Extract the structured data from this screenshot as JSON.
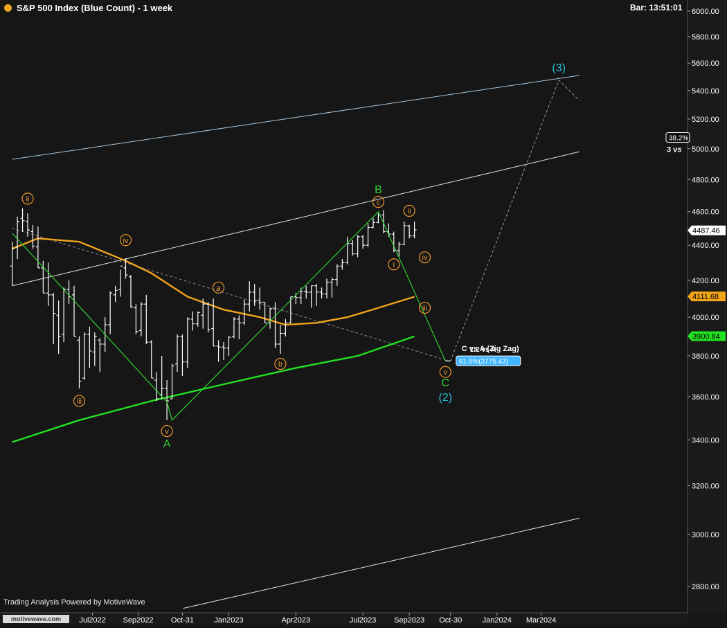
{
  "header": {
    "title": "S&P 500 Index (Blue Count) - 1 week",
    "bar_time": "Bar: 13:51:01"
  },
  "footer": {
    "powered_by": "Trading Analysis Powered by MotiveWave",
    "logo_text": "motivewave.com"
  },
  "colors": {
    "background": "#161616",
    "axis_panel": "#1a1a1a",
    "price_bars": "#ffffff",
    "wave_green": "#2fd02f",
    "wave_orange": "#f29a2e",
    "wave_cyan": "#29c0d6",
    "ma_orange": "#f2a51a",
    "ma_green": "#22e022",
    "channel_blue": "#a9c6dc",
    "channel_white": "#e6e6e6",
    "dashed": "#8a8a8a",
    "price_tag_bg": "#ffffff",
    "fib_tag_bg": "#3fb6ff"
  },
  "chart_data": {
    "type": "ohlc-bar",
    "title": "S&P 500 Index (Blue Count) - 1 week",
    "y_scale": "log",
    "ylim": [
      2700,
      6000
    ],
    "y_ticks": [
      2800,
      3000,
      3200,
      3400,
      3600,
      3800,
      4000,
      4200,
      4400,
      4600,
      4800,
      5000,
      5200,
      5400,
      5600,
      5800,
      6000
    ],
    "y_tick_labels": [
      "2800.00",
      "3000.00",
      "3200.00",
      "3400.00",
      "3600.00",
      "3800.00",
      "4000.00",
      "4200.00",
      "4400.00",
      "4600.00",
      "4800.00",
      "5000.00",
      "5200.00",
      "5400.00",
      "5600.00",
      "5800.00",
      "6000.00"
    ],
    "x_range": [
      "2022-03-14",
      "2024-04-22"
    ],
    "x_ticks": [
      {
        "date": "2022-07-01",
        "label": "Jul2022"
      },
      {
        "date": "2022-09-01",
        "label": "Sep2022"
      },
      {
        "date": "2022-10-31",
        "label": "Oct-31"
      },
      {
        "date": "2023-01-02",
        "label": "Jan2023"
      },
      {
        "date": "2023-04-03",
        "label": "Apr2023"
      },
      {
        "date": "2023-07-03",
        "label": "Jul2023"
      },
      {
        "date": "2023-09-04",
        "label": "Sep2023"
      },
      {
        "date": "2023-10-30",
        "label": "Oct-30"
      },
      {
        "date": "2024-01-01",
        "label": "Jan2024"
      },
      {
        "date": "2024-03-01",
        "label": "Mar2024"
      }
    ],
    "grid": false,
    "bars": [
      {
        "d": "2022-03-14",
        "o": 4280,
        "h": 4420,
        "l": 4170,
        "c": 4380
      },
      {
        "d": "2022-03-21",
        "o": 4390,
        "h": 4570,
        "l": 4320,
        "c": 4540
      },
      {
        "d": "2022-03-28",
        "o": 4560,
        "h": 4620,
        "l": 4480,
        "c": 4545
      },
      {
        "d": "2022-04-04",
        "o": 4540,
        "h": 4590,
        "l": 4450,
        "c": 4490
      },
      {
        "d": "2022-04-11",
        "o": 4480,
        "h": 4520,
        "l": 4380,
        "c": 4395
      },
      {
        "d": "2022-04-18",
        "o": 4390,
        "h": 4510,
        "l": 4270,
        "c": 4270
      },
      {
        "d": "2022-04-25",
        "o": 4270,
        "h": 4310,
        "l": 4130,
        "c": 4130
      },
      {
        "d": "2022-05-02",
        "o": 4130,
        "h": 4300,
        "l": 4060,
        "c": 4120
      },
      {
        "d": "2022-05-09",
        "o": 4120,
        "h": 4130,
        "l": 3860,
        "c": 4020
      },
      {
        "d": "2022-05-16",
        "o": 4010,
        "h": 4090,
        "l": 3810,
        "c": 3900
      },
      {
        "d": "2022-05-23",
        "o": 3910,
        "h": 4160,
        "l": 3870,
        "c": 4150
      },
      {
        "d": "2022-05-30",
        "o": 4150,
        "h": 4200,
        "l": 4070,
        "c": 4110
      },
      {
        "d": "2022-06-06",
        "o": 4120,
        "h": 4170,
        "l": 3900,
        "c": 3900
      },
      {
        "d": "2022-06-13",
        "o": 3880,
        "h": 3900,
        "l": 3640,
        "c": 3675
      },
      {
        "d": "2022-06-20",
        "o": 3690,
        "h": 3920,
        "l": 3680,
        "c": 3910
      },
      {
        "d": "2022-06-27",
        "o": 3910,
        "h": 3950,
        "l": 3740,
        "c": 3825
      },
      {
        "d": "2022-07-04",
        "o": 3820,
        "h": 3920,
        "l": 3750,
        "c": 3900
      },
      {
        "d": "2022-07-11",
        "o": 3880,
        "h": 3890,
        "l": 3720,
        "c": 3860
      },
      {
        "d": "2022-07-18",
        "o": 3860,
        "h": 4000,
        "l": 3820,
        "c": 3960
      },
      {
        "d": "2022-07-25",
        "o": 3960,
        "h": 4140,
        "l": 3910,
        "c": 4130
      },
      {
        "d": "2022-08-01",
        "o": 4120,
        "h": 4170,
        "l": 4080,
        "c": 4145
      },
      {
        "d": "2022-08-08",
        "o": 4150,
        "h": 4260,
        "l": 4110,
        "c": 4280
      },
      {
        "d": "2022-08-15",
        "o": 4270,
        "h": 4325,
        "l": 4210,
        "c": 4230
      },
      {
        "d": "2022-08-22",
        "o": 4220,
        "h": 4230,
        "l": 4050,
        "c": 4055
      },
      {
        "d": "2022-08-29",
        "o": 4050,
        "h": 4070,
        "l": 3910,
        "c": 3925
      },
      {
        "d": "2022-09-05",
        "o": 3930,
        "h": 4080,
        "l": 3900,
        "c": 4070
      },
      {
        "d": "2022-09-12",
        "o": 4070,
        "h": 4120,
        "l": 3860,
        "c": 3870
      },
      {
        "d": "2022-09-19",
        "o": 3870,
        "h": 3880,
        "l": 3690,
        "c": 3690
      },
      {
        "d": "2022-09-26",
        "o": 3680,
        "h": 3720,
        "l": 3580,
        "c": 3590
      },
      {
        "d": "2022-10-03",
        "o": 3610,
        "h": 3800,
        "l": 3590,
        "c": 3640
      },
      {
        "d": "2022-10-10",
        "o": 3640,
        "h": 3680,
        "l": 3490,
        "c": 3580
      },
      {
        "d": "2022-10-17",
        "o": 3590,
        "h": 3760,
        "l": 3590,
        "c": 3750
      },
      {
        "d": "2022-10-24",
        "o": 3760,
        "h": 3910,
        "l": 3720,
        "c": 3900
      },
      {
        "d": "2022-10-31",
        "o": 3900,
        "h": 3910,
        "l": 3700,
        "c": 3770
      },
      {
        "d": "2022-11-07",
        "o": 3770,
        "h": 4000,
        "l": 3740,
        "c": 3990
      },
      {
        "d": "2022-11-14",
        "o": 3990,
        "h": 4030,
        "l": 3930,
        "c": 3965
      },
      {
        "d": "2022-11-21",
        "o": 3965,
        "h": 4030,
        "l": 3950,
        "c": 4025
      },
      {
        "d": "2022-11-28",
        "o": 4010,
        "h": 4100,
        "l": 3940,
        "c": 4070
      },
      {
        "d": "2022-12-05",
        "o": 4070,
        "h": 4080,
        "l": 3920,
        "c": 3935
      },
      {
        "d": "2022-12-12",
        "o": 3940,
        "h": 4100,
        "l": 3850,
        "c": 3850
      },
      {
        "d": "2022-12-19",
        "o": 3850,
        "h": 3880,
        "l": 3770,
        "c": 3845
      },
      {
        "d": "2022-12-26",
        "o": 3845,
        "h": 3870,
        "l": 3780,
        "c": 3840
      },
      {
        "d": "2023-01-02",
        "o": 3840,
        "h": 3900,
        "l": 3800,
        "c": 3895
      },
      {
        "d": "2023-01-09",
        "o": 3900,
        "h": 4000,
        "l": 3890,
        "c": 3990
      },
      {
        "d": "2023-01-16",
        "o": 3990,
        "h": 4010,
        "l": 3885,
        "c": 3970
      },
      {
        "d": "2023-01-23",
        "o": 3970,
        "h": 4095,
        "l": 3960,
        "c": 4070
      },
      {
        "d": "2023-01-30",
        "o": 4070,
        "h": 4195,
        "l": 4030,
        "c": 4135
      },
      {
        "d": "2023-02-06",
        "o": 4135,
        "h": 4180,
        "l": 4060,
        "c": 4090
      },
      {
        "d": "2023-02-13",
        "o": 4090,
        "h": 4160,
        "l": 4040,
        "c": 4080
      },
      {
        "d": "2023-02-20",
        "o": 4080,
        "h": 4080,
        "l": 3970,
        "c": 3970
      },
      {
        "d": "2023-02-27",
        "o": 3970,
        "h": 4050,
        "l": 3940,
        "c": 4045
      },
      {
        "d": "2023-03-06",
        "o": 4045,
        "h": 4080,
        "l": 3840,
        "c": 3860
      },
      {
        "d": "2023-03-13",
        "o": 3860,
        "h": 3960,
        "l": 3810,
        "c": 3915
      },
      {
        "d": "2023-03-20",
        "o": 3915,
        "h": 3990,
        "l": 3900,
        "c": 3970
      },
      {
        "d": "2023-03-27",
        "o": 3970,
        "h": 4110,
        "l": 3970,
        "c": 4110
      },
      {
        "d": "2023-04-03",
        "o": 4110,
        "h": 4130,
        "l": 4070,
        "c": 4105
      },
      {
        "d": "2023-04-10",
        "o": 4105,
        "h": 4160,
        "l": 4070,
        "c": 4140
      },
      {
        "d": "2023-04-17",
        "o": 4140,
        "h": 4170,
        "l": 4100,
        "c": 4135
      },
      {
        "d": "2023-04-24",
        "o": 4135,
        "h": 4170,
        "l": 4050,
        "c": 4170
      },
      {
        "d": "2023-05-01",
        "o": 4170,
        "h": 4180,
        "l": 4060,
        "c": 4135
      },
      {
        "d": "2023-05-08",
        "o": 4135,
        "h": 4160,
        "l": 4100,
        "c": 4125
      },
      {
        "d": "2023-05-15",
        "o": 4125,
        "h": 4210,
        "l": 4100,
        "c": 4190
      },
      {
        "d": "2023-05-22",
        "o": 4190,
        "h": 4215,
        "l": 4105,
        "c": 4205
      },
      {
        "d": "2023-05-29",
        "o": 4205,
        "h": 4290,
        "l": 4170,
        "c": 4280
      },
      {
        "d": "2023-06-05",
        "o": 4280,
        "h": 4320,
        "l": 4260,
        "c": 4300
      },
      {
        "d": "2023-06-12",
        "o": 4300,
        "h": 4450,
        "l": 4290,
        "c": 4410
      },
      {
        "d": "2023-06-19",
        "o": 4410,
        "h": 4430,
        "l": 4340,
        "c": 4350
      },
      {
        "d": "2023-06-26",
        "o": 4350,
        "h": 4460,
        "l": 4330,
        "c": 4450
      },
      {
        "d": "2023-07-03",
        "o": 4450,
        "h": 4460,
        "l": 4380,
        "c": 4400
      },
      {
        "d": "2023-07-10",
        "o": 4400,
        "h": 4530,
        "l": 4390,
        "c": 4505
      },
      {
        "d": "2023-07-17",
        "o": 4505,
        "h": 4560,
        "l": 4500,
        "c": 4535
      },
      {
        "d": "2023-07-24",
        "o": 4535,
        "h": 4590,
        "l": 4530,
        "c": 4580
      },
      {
        "d": "2023-07-31",
        "o": 4580,
        "h": 4610,
        "l": 4470,
        "c": 4480
      },
      {
        "d": "2023-08-07",
        "o": 4480,
        "h": 4530,
        "l": 4450,
        "c": 4465
      },
      {
        "d": "2023-08-14",
        "o": 4465,
        "h": 4480,
        "l": 4360,
        "c": 4370
      },
      {
        "d": "2023-08-21",
        "o": 4370,
        "h": 4420,
        "l": 4335,
        "c": 4405
      },
      {
        "d": "2023-08-28",
        "o": 4405,
        "h": 4540,
        "l": 4400,
        "c": 4515
      },
      {
        "d": "2023-09-04",
        "o": 4515,
        "h": 4520,
        "l": 4440,
        "c": 4455
      },
      {
        "d": "2023-09-11",
        "o": 4455,
        "h": 4540,
        "l": 4440,
        "c": 4490
      }
    ],
    "moving_averages": [
      {
        "color": "orange",
        "points": [
          [
            "2022-03-14",
            4380
          ],
          [
            "2022-04-18",
            4440
          ],
          [
            "2022-06-13",
            4420
          ],
          [
            "2022-08-15",
            4310
          ],
          [
            "2022-09-19",
            4240
          ],
          [
            "2022-11-07",
            4110
          ],
          [
            "2022-12-26",
            4040
          ],
          [
            "2023-02-13",
            4000
          ],
          [
            "2023-03-20",
            3960
          ],
          [
            "2023-05-01",
            3970
          ],
          [
            "2023-06-12",
            4000
          ],
          [
            "2023-07-24",
            4050
          ],
          [
            "2023-09-11",
            4110
          ]
        ]
      },
      {
        "color": "green",
        "points": [
          [
            "2022-03-14",
            3390
          ],
          [
            "2022-06-13",
            3490
          ],
          [
            "2022-09-19",
            3580
          ],
          [
            "2022-12-26",
            3660
          ],
          [
            "2023-04-03",
            3740
          ],
          [
            "2023-06-26",
            3800
          ],
          [
            "2023-09-11",
            3900
          ]
        ]
      }
    ],
    "price_tags": [
      {
        "label": "4487.46",
        "value": 4487.46,
        "color": "white"
      },
      {
        "label": "4111.68",
        "value": 4111.68,
        "color": "orange"
      },
      {
        "label": "3900.84",
        "value": 3900.84,
        "color": "green"
      }
    ],
    "wave_path_green": [
      [
        "2022-03-14",
        4470
      ],
      [
        "2022-10-10",
        3575
      ],
      [
        "2022-10-17",
        3490
      ],
      [
        "2023-07-24",
        4600
      ],
      [
        "2023-10-23",
        3775
      ]
    ],
    "projection_dashed": [
      [
        "2023-10-23",
        3775
      ],
      [
        "2023-10-30",
        3775
      ],
      [
        "2024-03-25",
        5475
      ],
      [
        "2024-04-22",
        5330
      ]
    ],
    "channel_lines": [
      {
        "color": "blue",
        "from": [
          "2022-03-14",
          4930
        ],
        "to": [
          "2024-04-22",
          5510
        ]
      },
      {
        "color": "white",
        "from": [
          "2022-03-14",
          4170
        ],
        "to": [
          "2024-04-22",
          4980
        ]
      },
      {
        "color": "white",
        "from": [
          "2022-11-01",
          2720
        ],
        "to": [
          "2024-04-22",
          3065
        ]
      },
      {
        "color": "dashed",
        "from": [
          "2022-03-14",
          4500
        ],
        "to": [
          "2023-10-23",
          3780
        ]
      }
    ],
    "wave_labels": [
      {
        "text": "ii",
        "d": "2022-04-04",
        "v": 4680,
        "style": "circle-orange"
      },
      {
        "text": "iii",
        "d": "2022-06-13",
        "v": 3580,
        "style": "circle-orange"
      },
      {
        "text": "iv",
        "d": "2022-08-15",
        "v": 4430,
        "style": "circle-orange"
      },
      {
        "text": "v",
        "d": "2022-10-10",
        "v": 3440,
        "style": "circle-orange"
      },
      {
        "text": "A",
        "d": "2022-10-10",
        "v": 3385,
        "style": "green"
      },
      {
        "text": "a",
        "d": "2022-12-19",
        "v": 4160,
        "style": "circle-orange"
      },
      {
        "text": "b",
        "d": "2023-03-13",
        "v": 3760,
        "style": "circle-orange"
      },
      {
        "text": "B",
        "d": "2023-07-24",
        "v": 4740,
        "style": "green"
      },
      {
        "text": "c",
        "d": "2023-07-24",
        "v": 4660,
        "style": "circle-orange"
      },
      {
        "text": "i",
        "d": "2023-08-14",
        "v": 4290,
        "style": "circle-orange"
      },
      {
        "text": "ii",
        "d": "2023-09-04",
        "v": 4605,
        "style": "circle-orange"
      },
      {
        "text": "iii",
        "d": "2023-09-25",
        "v": 4050,
        "style": "circle-orange"
      },
      {
        "text": "iv",
        "d": "2023-09-25",
        "v": 4330,
        "style": "circle-orange"
      },
      {
        "text": "v",
        "d": "2023-10-23",
        "v": 3720,
        "style": "circle-orange"
      },
      {
        "text": "C",
        "d": "2023-10-23",
        "v": 3670,
        "style": "green"
      },
      {
        "text": "(2)",
        "d": "2023-10-23",
        "v": 3600,
        "style": "cyan"
      },
      {
        "text": "(3)",
        "d": "2024-03-25",
        "v": 5570,
        "style": "cyan"
      }
    ],
    "annotations": {
      "fib_title": "C vs A (Zig Zag)",
      "fib_value": "61.8%(3775.43)",
      "fib_value_num": 3775.43,
      "fib_overlap": "1.2 vs A",
      "tr_box": "38.2%",
      "tr_box_num": 5075,
      "tr_label": "3 vs"
    }
  }
}
